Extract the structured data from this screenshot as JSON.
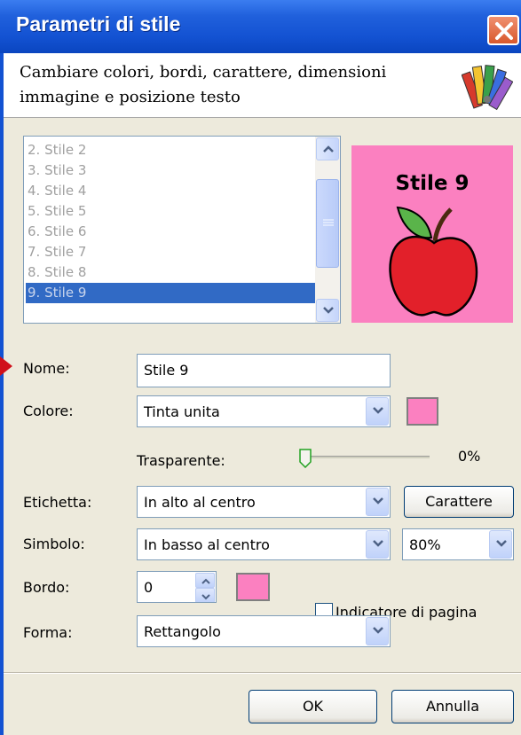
{
  "window": {
    "title": "Parametri di stile",
    "close_icon": "close-icon"
  },
  "header": {
    "description": "Cambiare colori, bordi, carattere, dimensioni immagine e posizione testo",
    "icon": "color-palette-icon"
  },
  "style_list": {
    "items": [
      "2.  Stile 2",
      "3.  Stile 3",
      "4.  Stile 4",
      "5.  Stile 5",
      "6.  Stile 6",
      "7.  Stile 7",
      "8.  Stile 8",
      "9.  Stile 9"
    ],
    "selected_index": 7
  },
  "preview": {
    "title": "Stile 9",
    "symbol": "apple-icon",
    "background": "#fb80c0"
  },
  "form": {
    "name": {
      "label": "Nome:",
      "value": "Stile 9"
    },
    "color": {
      "label": "Colore:",
      "value": "Tinta unita",
      "swatch": "#fb80c0"
    },
    "transparency": {
      "label": "Trasparente:",
      "value": "0%"
    },
    "label": {
      "label": "Etichetta:",
      "value": "In alto al centro",
      "font_button": "Carattere"
    },
    "symbol": {
      "label": "Simbolo:",
      "value": "In basso al centro",
      "size": "80%"
    },
    "border": {
      "label": "Bordo:",
      "value": "0",
      "swatch": "#fb80c0",
      "page_indicator": "Indicatore di pagina",
      "page_indicator_checked": false
    },
    "shape": {
      "label": "Forma:",
      "value": "Rettangolo"
    }
  },
  "buttons": {
    "ok": "OK",
    "cancel": "Annulla"
  }
}
